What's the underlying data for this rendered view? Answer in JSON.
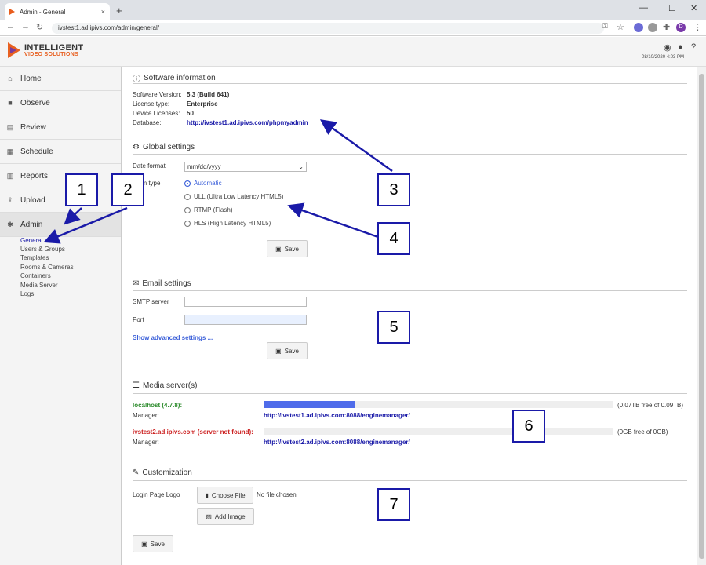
{
  "browser": {
    "tab_title": "Admin - General",
    "tab_close": "×",
    "new_tab": "+",
    "url": "ivstest1.ad.ipivs.com/admin/general/",
    "minimize": "—",
    "maximize": "☐",
    "close": "✕",
    "profile_initial": "D"
  },
  "header": {
    "logo_line1": "INTELLIGENT",
    "logo_line2": "VIDEO SOLUTIONS",
    "datetime": "08/10/2020 4:03 PM"
  },
  "sidebar": {
    "items": [
      {
        "label": "Home",
        "icon": "home-icon"
      },
      {
        "label": "Observe",
        "icon": "camera-icon"
      },
      {
        "label": "Review",
        "icon": "film-icon"
      },
      {
        "label": "Schedule",
        "icon": "calendar-icon"
      },
      {
        "label": "Reports",
        "icon": "bar-chart-icon"
      },
      {
        "label": "Upload",
        "icon": "upload-icon"
      },
      {
        "label": "Admin",
        "icon": "gear-icon"
      }
    ],
    "subitems": [
      "General",
      "Users & Groups",
      "Templates",
      "Rooms & Cameras",
      "Containers",
      "Media Server",
      "Logs"
    ]
  },
  "software": {
    "title": "Software information",
    "version_label": "Software Version:",
    "version": "5.3 (Build 641)",
    "license_label": "License type:",
    "license": "Enterprise",
    "devices_label": "Device Licenses:",
    "devices": "50",
    "db_label": "Database:",
    "db_link": "http://ivstest1.ad.ipivs.com/phpmyadmin"
  },
  "global": {
    "title": "Global settings",
    "date_format_label": "Date format",
    "date_format_value": "mm/dd/yyyy",
    "stream_type_label": "am type",
    "stream_options": [
      "Automatic",
      "ULL (Ultra Low Latency HTML5)",
      "RTMP (Flash)",
      "HLS (High Latency HTML5)"
    ],
    "selected_stream": "Automatic",
    "save": "Save"
  },
  "email": {
    "title": "Email settings",
    "smtp_label": "SMTP server",
    "smtp_value": "",
    "port_label": "Port",
    "port_value": "",
    "advanced": "Show advanced settings ...",
    "save": "Save"
  },
  "media": {
    "title": "Media server(s)",
    "servers": [
      {
        "name": "localhost (4.7.8):",
        "status_color": "#2a8a2a",
        "manager_label": "Manager:",
        "manager_link": "http://ivstest1.ad.ipivs.com:8088/enginemanager/",
        "usage_text": "(0.07TB  free of  0.09TB)",
        "used_fraction": 0.26
      },
      {
        "name": "ivstest2.ad.ipivs.com (server not found):",
        "status_color": "#cc2222",
        "manager_label": "Manager:",
        "manager_link": "http://ivstest2.ad.ipivs.com:8088/enginemanager/",
        "usage_text": "(0GB  free of  0GB)",
        "used_fraction": 0
      }
    ]
  },
  "customization": {
    "title": "Customization",
    "logo_label": "Login Page Logo",
    "choose_file": "Choose File",
    "no_file": "No file chosen",
    "add_image": "Add Image",
    "save": "Save"
  },
  "callouts": [
    "1",
    "2",
    "3",
    "4",
    "5",
    "6",
    "7"
  ],
  "colors": {
    "annotation": "#1a1aa8",
    "link": "#1a1aa8",
    "accent": "#e86020"
  }
}
